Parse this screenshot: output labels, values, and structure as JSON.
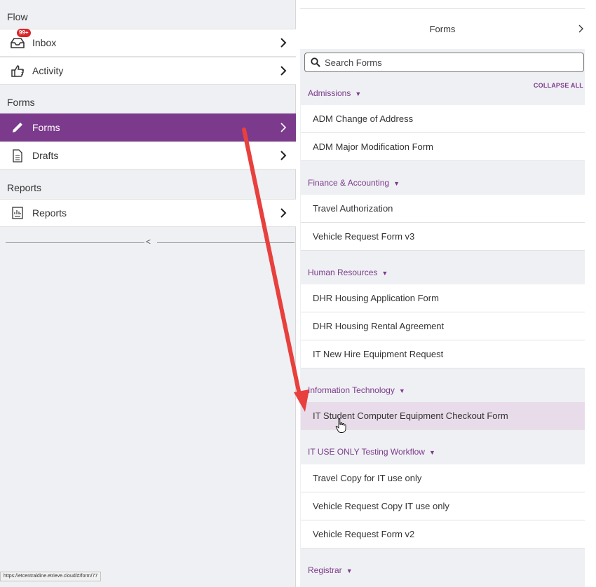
{
  "left_panel": {
    "sections": {
      "flow": "Flow",
      "forms": "Forms",
      "reports": "Reports"
    },
    "nav": {
      "inbox": {
        "label": "Inbox",
        "badge": "99+",
        "icon": "inbox-icon"
      },
      "activity": {
        "label": "Activity",
        "icon": "thumbs-up-icon"
      },
      "forms": {
        "label": "Forms",
        "icon": "pencil-icon",
        "active": true
      },
      "drafts": {
        "label": "Drafts",
        "icon": "document-icon"
      },
      "reports": {
        "label": "Reports",
        "icon": "report-icon"
      }
    },
    "collapse_glyph": "<"
  },
  "right_panel": {
    "title": "Forms",
    "search_placeholder": "Search Forms",
    "collapse_all": "COLLAPSE ALL",
    "categories": [
      {
        "name": "Admissions",
        "items": [
          "ADM Change of Address",
          "ADM Major Modification Form"
        ]
      },
      {
        "name": "Finance & Accounting",
        "items": [
          "Travel Authorization",
          "Vehicle Request Form v3"
        ]
      },
      {
        "name": "Human Resources",
        "items": [
          "DHR Housing Application Form",
          "DHR Housing Rental Agreement",
          "IT New Hire Equipment Request"
        ]
      },
      {
        "name": "Information Technology",
        "items": [
          "IT Student Computer Equipment Checkout Form"
        ]
      },
      {
        "name": "IT USE ONLY Testing Workflow",
        "items": [
          "Travel Copy for IT use only",
          "Vehicle Request Copy IT use only",
          "Vehicle Request Form v2"
        ]
      },
      {
        "name": "Registrar",
        "items": []
      }
    ],
    "hovered_item": "IT Student Computer Equipment Checkout Form"
  },
  "status_bar": "https://etcentraldine.etrieve.cloud/#/form/77",
  "colors": {
    "accent": "#7b3a8c",
    "badge": "#d9262a",
    "annotation_arrow": "#e8403d",
    "panel_bg": "#eff0f3"
  }
}
